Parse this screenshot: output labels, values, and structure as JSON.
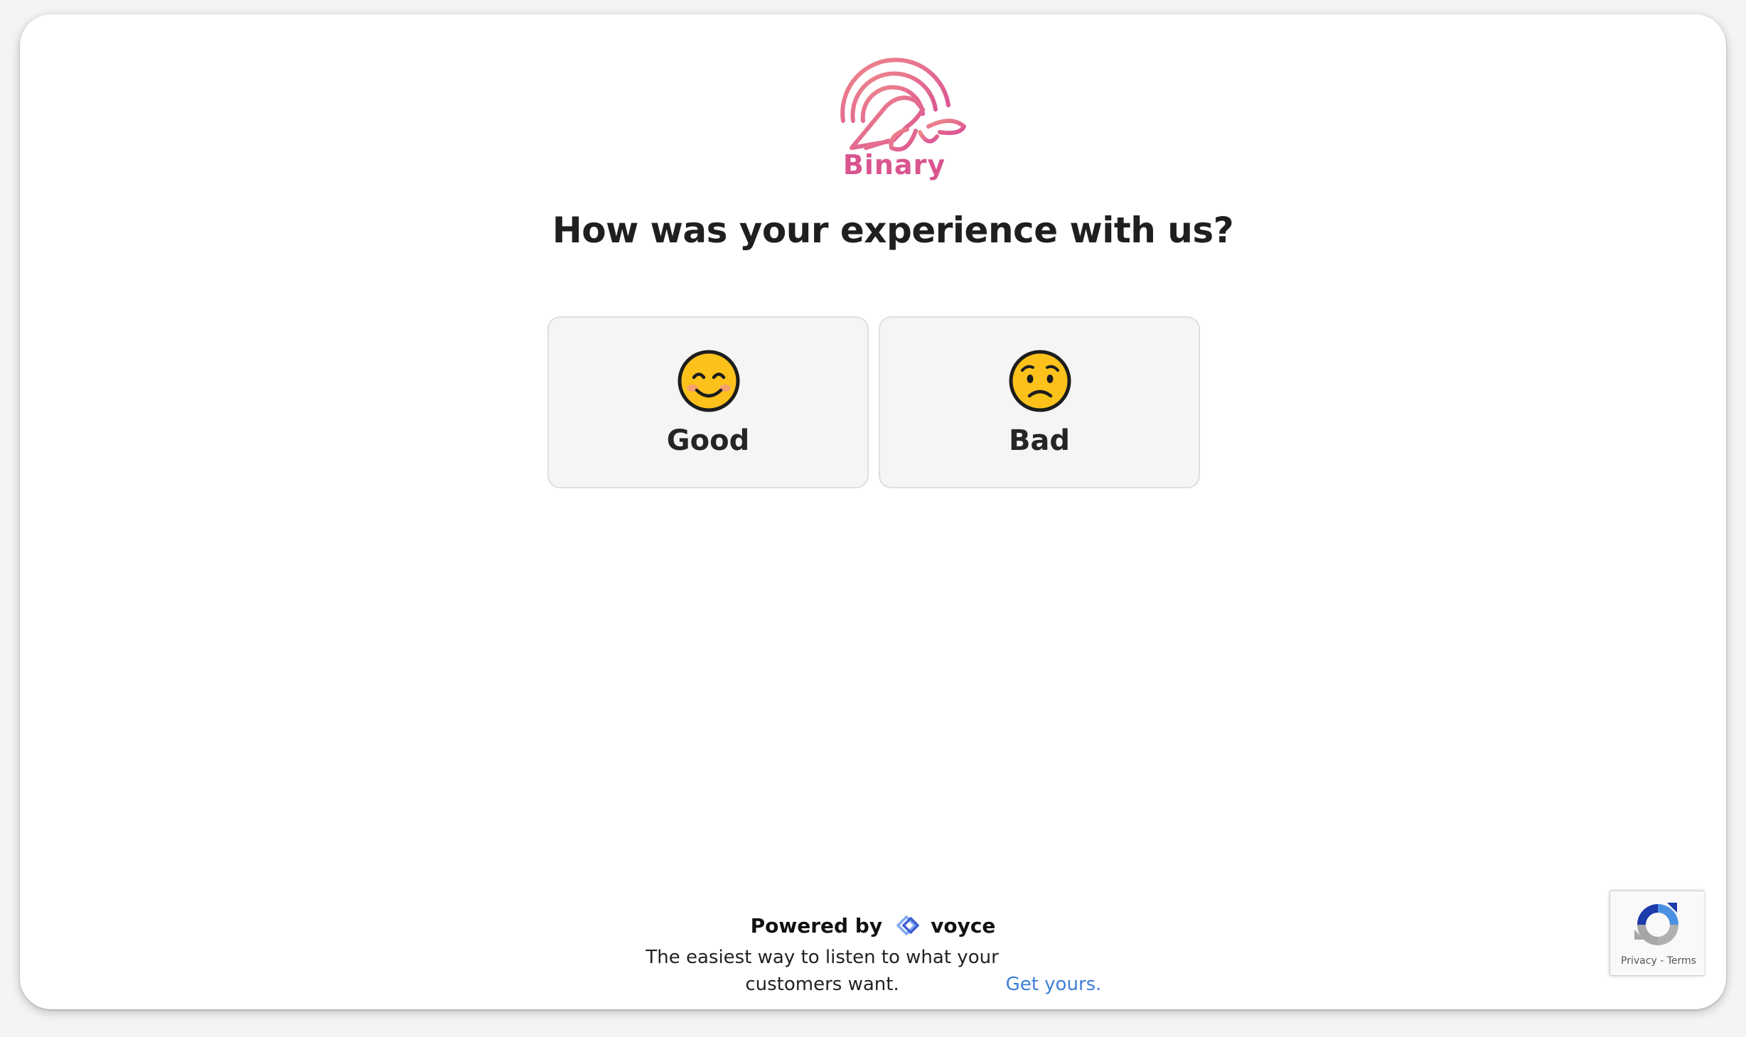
{
  "brand": {
    "name": "Binary",
    "logo_icon": "bird-logo-icon",
    "color": "#d9558f"
  },
  "survey": {
    "question": "How was your experience with us?",
    "options": [
      {
        "label": "Good",
        "icon": "smiling-face-icon"
      },
      {
        "label": "Bad",
        "icon": "worried-face-icon"
      }
    ]
  },
  "footer": {
    "powered_by": "Powered by",
    "vendor": "voyce",
    "vendor_icon": "voyce-logo-icon",
    "tagline": "The easiest way to listen to what your customers want.",
    "cta_link": "Get yours.",
    "link_color": "#3f7fd6"
  },
  "recaptcha": {
    "icon": "recaptcha-icon",
    "privacy": "Privacy",
    "separator": "-",
    "terms": "Terms"
  }
}
